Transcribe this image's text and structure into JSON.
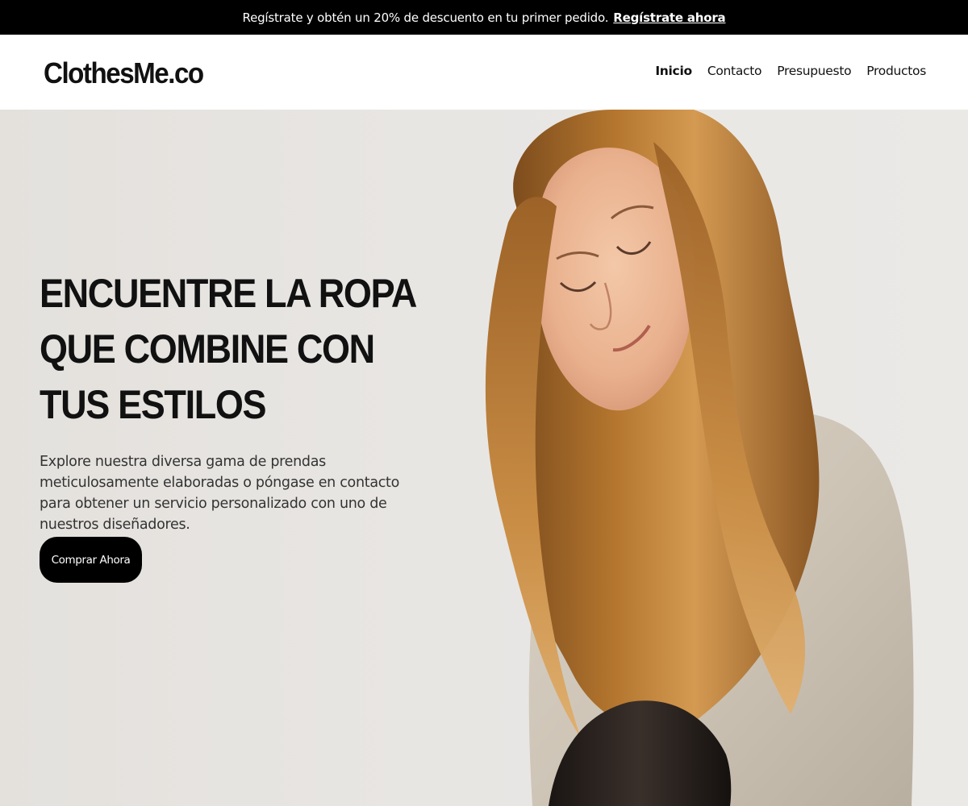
{
  "promo": {
    "text": "Regístrate y obtén un 20% de descuento en tu primer pedido.",
    "link_label": "Regístrate ahora"
  },
  "header": {
    "logo": "ClothesMe.co",
    "nav": [
      {
        "label": "Inicio",
        "active": true
      },
      {
        "label": "Contacto"
      },
      {
        "label": "Presupuesto"
      },
      {
        "label": "Productos"
      }
    ]
  },
  "hero": {
    "title_lines": [
      "ENCUENTRE LA ROPA",
      "QUE COMBINE CON",
      "TUS ESTILOS"
    ],
    "description": "Explore nuestra diversa gama de prendas meticulosamente elaboradas o póngase en contacto para obtener un servicio personalizado con uno de nuestros diseñadores.",
    "cta_label": "Comprar Ahora"
  },
  "colors": {
    "promo_bg": "#000000",
    "header_bg": "#ffffff",
    "hero_bg": "#e8e6e3",
    "button_bg": "#000000"
  }
}
